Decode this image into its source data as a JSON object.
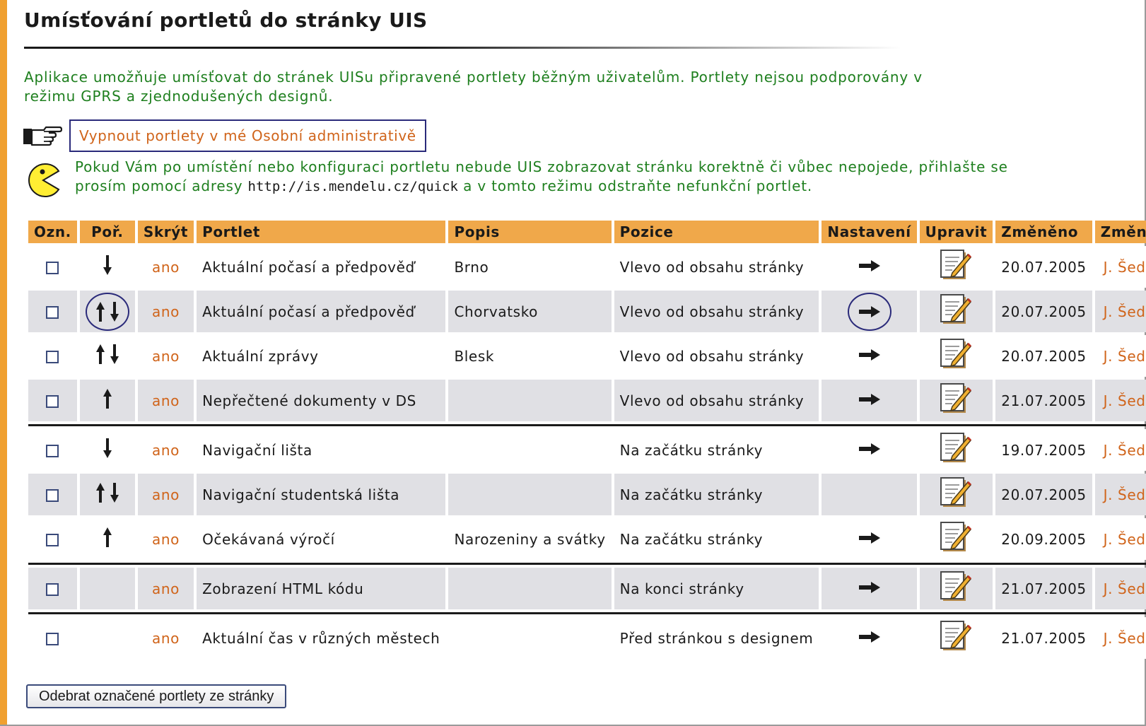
{
  "page": {
    "title": "Umísťování portletů do stránky UIS",
    "intro": "Aplikace umožňuje umísťovat do stránek UISu připravené portlety běžným uživatelům. Portlety nejsou podporovány v režimu GPRS a zjednodušených designů.",
    "disable_link": "Vypnout portlety v mé Osobní administrativě",
    "notice_before": "Pokud Vám po umístění nebo konfiguraci portletu nebude UIS zobrazovat stránku korektně či vůbec nepojede, přihlašte se prosím pomocí adresy ",
    "notice_url": "http://is.mendelu.cz/quick",
    "notice_after": " a v tomto režimu odstraňte nefunkční portlet."
  },
  "table": {
    "headers": [
      "Ozn.",
      "Poř.",
      "Skrýt",
      "Portlet",
      "Popis",
      "Pozice",
      "Nastavení",
      "Upravit",
      "Změněno",
      "Změnil"
    ],
    "rows": [
      {
        "arrows": "down",
        "hide": "ano",
        "portlet": "Aktuální počasí a předpověď",
        "popis": "Brno",
        "pozice": "Vlevo od obsahu stránky",
        "settings": true,
        "changed": "20.07.2005",
        "changed_by": "J. Šedá",
        "highlight": false
      },
      {
        "arrows": "both",
        "hide": "ano",
        "portlet": "Aktuální počasí a předpověď",
        "popis": "Chorvatsko",
        "pozice": "Vlevo od obsahu stránky",
        "settings": true,
        "changed": "20.07.2005",
        "changed_by": "J. Šedá",
        "highlight": true
      },
      {
        "arrows": "both",
        "hide": "ano",
        "portlet": "Aktuální zprávy",
        "popis": "Blesk",
        "pozice": "Vlevo od obsahu stránky",
        "settings": true,
        "changed": "20.07.2005",
        "changed_by": "J. Šedá",
        "highlight": false
      },
      {
        "arrows": "up",
        "hide": "ano",
        "portlet": "Nepřečtené dokumenty v DS",
        "popis": "",
        "pozice": "Vlevo od obsahu stránky",
        "settings": true,
        "changed": "21.07.2005",
        "changed_by": "J. Šedá",
        "highlight": false,
        "group_end": true
      },
      {
        "arrows": "down",
        "hide": "ano",
        "portlet": "Navigační lišta",
        "popis": "",
        "pozice": "Na začátku stránky",
        "settings": true,
        "changed": "19.07.2005",
        "changed_by": "J. Šedá",
        "highlight": false
      },
      {
        "arrows": "both",
        "hide": "ano",
        "portlet": "Navigační studentská lišta",
        "popis": "",
        "pozice": "Na začátku stránky",
        "settings": false,
        "changed": "20.07.2005",
        "changed_by": "J. Šedá",
        "highlight": false
      },
      {
        "arrows": "up",
        "hide": "ano",
        "portlet": "Očekávaná výročí",
        "popis": "Narozeniny a svátky",
        "pozice": "Na začátku stránky",
        "settings": true,
        "changed": "20.09.2005",
        "changed_by": "J. Šedá",
        "highlight": false,
        "group_end": true
      },
      {
        "arrows": "none",
        "hide": "ano",
        "portlet": "Zobrazení HTML kódu",
        "popis": "",
        "pozice": "Na konci stránky",
        "settings": true,
        "changed": "21.07.2005",
        "changed_by": "J. Šedá",
        "highlight": false,
        "group_end": true
      },
      {
        "arrows": "none",
        "hide": "ano",
        "portlet": "Aktuální čas v různých městech",
        "popis": "",
        "pozice": "Před stránkou s designem",
        "settings": true,
        "changed": "21.07.2005",
        "changed_by": "J. Šedá",
        "highlight": false
      }
    ]
  },
  "remove_button": "Odebrat označené portlety ze stránky",
  "colors": {
    "accent": "#f0a84a",
    "link": "#d0641a",
    "info_text": "#1e7f1e",
    "row_alt": "#e0e0e4"
  },
  "icons": {
    "hand": "pointing-hand-icon",
    "pacman": "warning-pacman-icon",
    "settings": "arrow-right-icon",
    "edit": "edit-note-icon"
  }
}
